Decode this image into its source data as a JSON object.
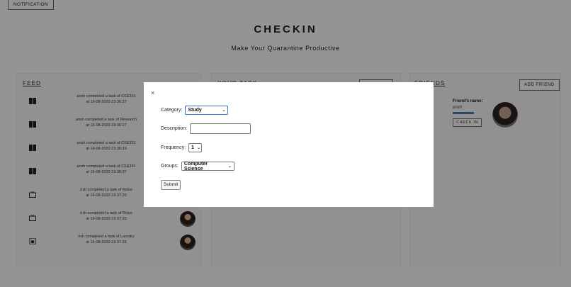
{
  "header": {
    "notification_label": "NOTIFICATION",
    "title": "CHECKIN",
    "subtitle": "Make Your Quarantine Productive"
  },
  "feed": {
    "heading": "FEED",
    "items": [
      {
        "line1": "ansh completed a task of CSE331",
        "line2": "at 16-08-2020 23:36:27",
        "icon": "book-icon"
      },
      {
        "line1": "ansh completed a task of Research",
        "line2": "at 16-08-2020 23:36:27",
        "icon": "book-icon"
      },
      {
        "line1": "ansh completed a task of CSE331",
        "line2": "at 16-08-2020 23:36:33",
        "icon": "book-icon"
      },
      {
        "line1": "ansh completed a task of CSE331",
        "line2": "at 16-08-2020 23:36:37",
        "icon": "book-icon"
      },
      {
        "line1": "rish completed a task of Relax",
        "line2": "at 16-08-2020 23:37:20",
        "icon": "tv-icon"
      },
      {
        "line1": "rish completed a task of Relax",
        "line2": "at 16-08-2020 23:37:20",
        "icon": "tv-icon"
      },
      {
        "line1": "rish completed a task of Laundry",
        "line2": "at 16-08-2020 23:37:28",
        "icon": "washer-icon"
      }
    ]
  },
  "task": {
    "heading": "YOUR TASK"
  },
  "friends": {
    "heading": "FRIENDS",
    "add_label": "ADD FRIEND",
    "name_label": "Friend's name:",
    "name": "ansh",
    "checkin_label": "CHECK IN"
  },
  "modal": {
    "close_label": "×",
    "category_label": "Category:",
    "category_value": "Study",
    "description_label": "Description:",
    "description_value": "",
    "frequency_label": "Frequency:",
    "frequency_value": "1",
    "groups_label": "Groups:",
    "groups_value": "Computer Science",
    "submit_label": "Submit"
  }
}
